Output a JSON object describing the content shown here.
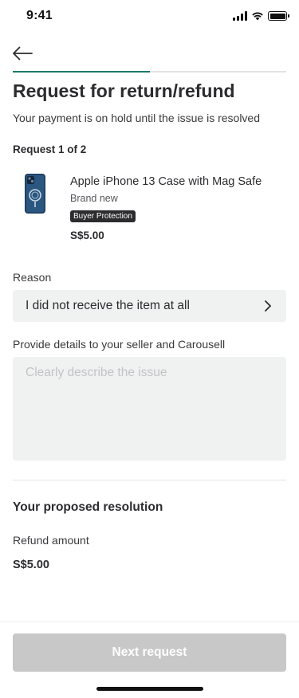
{
  "status_bar": {
    "time": "9:41",
    "icons": [
      "signal-icon",
      "wifi-icon",
      "battery-icon"
    ]
  },
  "header": {
    "back_icon": "arrow-left-icon",
    "progress_fraction": 0.5
  },
  "page": {
    "title": "Request for return/refund",
    "subtitle": "Your payment is on hold until the issue is resolved",
    "request_counter": "Request 1 of 2"
  },
  "item": {
    "name": "Apple iPhone  13 Case with Mag Safe",
    "condition": "Brand new",
    "badge": "Buyer Protection",
    "price": "S$5.00",
    "thumbnail_icon": "phone-case-image"
  },
  "reason": {
    "label": "Reason",
    "value": "I did not receive the item at all",
    "chevron_icon": "chevron-right-icon"
  },
  "details": {
    "label": "Provide details to your seller and Carousell",
    "placeholder": "Clearly describe the issue",
    "value": ""
  },
  "resolution": {
    "title": "Your proposed resolution",
    "refund_label": "Refund amount",
    "refund_amount": "S$5.00"
  },
  "footer": {
    "next_label": "Next request"
  },
  "colors": {
    "accent": "#1b7a6b",
    "text_primary": "#2c2c2f",
    "field_bg": "#f0f1f1",
    "button_disabled": "#c8c8c9",
    "badge_bg": "#2c2c2f"
  }
}
